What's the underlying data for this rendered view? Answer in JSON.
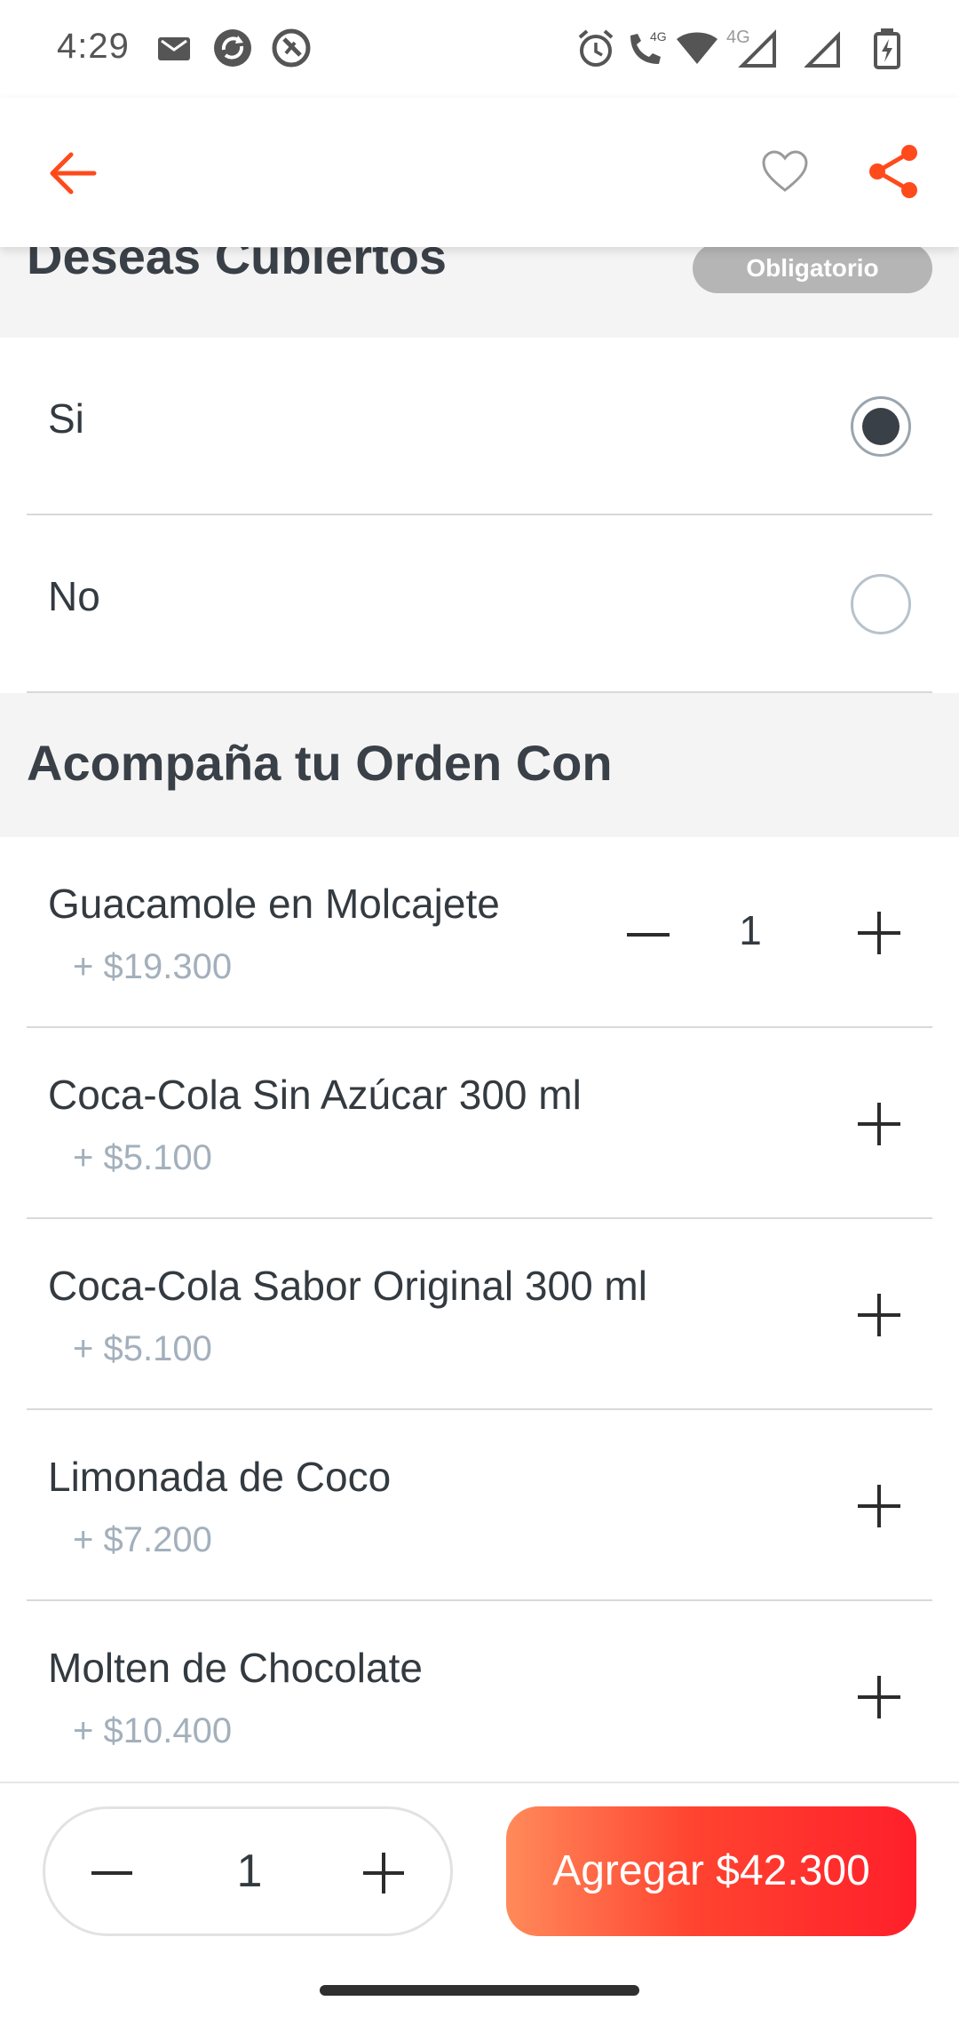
{
  "status_bar": {
    "time": "4:29",
    "left_icons": [
      "mail-icon",
      "sync-app-icon",
      "no-sim-icon"
    ],
    "right_icons": [
      "alarm-icon",
      "volte-call-icon",
      "wifi-icon",
      "signal-4g-icon",
      "signal-icon",
      "signal-icon",
      "battery-charging-icon"
    ],
    "network_label_1": "4G",
    "network_label_2": "4G"
  },
  "app_bar": {
    "back_icon": "arrow-left-icon",
    "favorite_icon": "heart-outline-icon",
    "share_icon": "share-icon",
    "accent_color": "#ff4a1c"
  },
  "cutlery_section": {
    "title": "Deseas Cubiertos",
    "badge": "Obligatorio",
    "options": [
      {
        "label": "Si",
        "selected": true
      },
      {
        "label": "No",
        "selected": false
      }
    ]
  },
  "extras_section": {
    "title": "Acompaña tu Orden Con",
    "items": [
      {
        "name": "Guacamole en Molcajete",
        "price": "+ $19.300",
        "quantity": "1"
      },
      {
        "name": "Coca-Cola Sin Azúcar 300 ml",
        "price": "+ $5.100"
      },
      {
        "name": "Coca-Cola Sabor Original 300 ml",
        "price": "+ $5.100"
      },
      {
        "name": "Limonada de Coco",
        "price": "+ $7.200"
      },
      {
        "name": "Molten de Chocolate",
        "price": "+ $10.400"
      }
    ]
  },
  "bottom_bar": {
    "quantity": "1",
    "add_label": "Agregar $42.300"
  }
}
